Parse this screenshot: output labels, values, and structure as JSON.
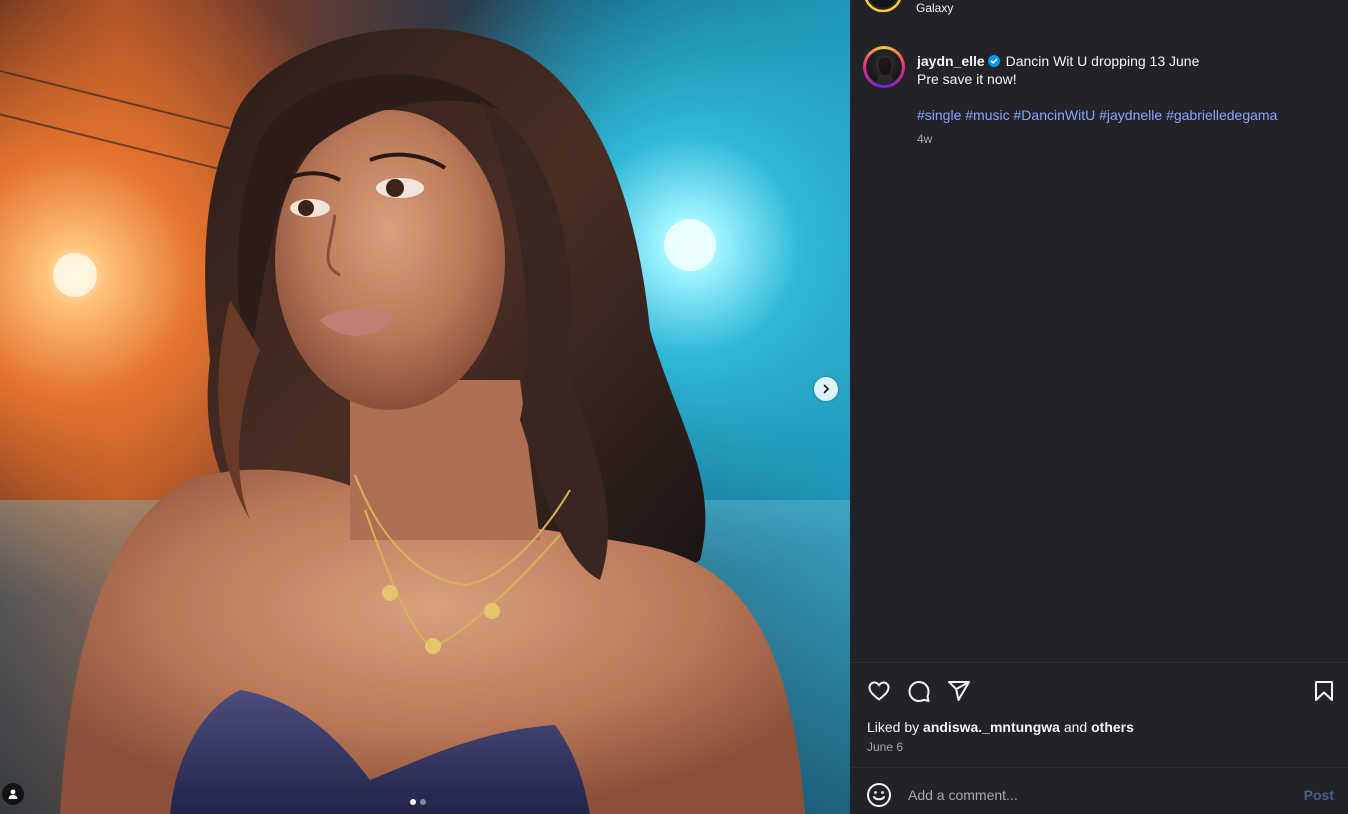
{
  "post": {
    "location": "Galaxy",
    "author": {
      "username": "jaydn_elle",
      "verified": true
    },
    "caption_line1": "Dancin Wit U dropping 13 June",
    "caption_line2": "Pre save it now!",
    "hashtags": [
      "#single",
      "#music",
      "#DancinWitU",
      "#jaydnelle",
      "#gabrielledegama"
    ],
    "time_ago": "4w",
    "carousel": {
      "total": 2,
      "current": 1
    }
  },
  "likes": {
    "prefix": "Liked by",
    "user": "andiswa._mntungwa",
    "conjunction": "and",
    "others": "others"
  },
  "date": "June 6",
  "comment": {
    "placeholder": "Add a comment...",
    "post_label": "Post"
  },
  "icons": {
    "like": "heart-icon",
    "comment": "comment-icon",
    "share": "share-icon",
    "save": "bookmark-icon",
    "emoji": "emoji-icon",
    "next": "chevron-right-icon",
    "tags": "user-tag-icon"
  },
  "colors": {
    "background": "#212328",
    "hashtag": "#8aa4ff",
    "post_disabled": "#4a5f86",
    "verified": "#0095f6"
  }
}
